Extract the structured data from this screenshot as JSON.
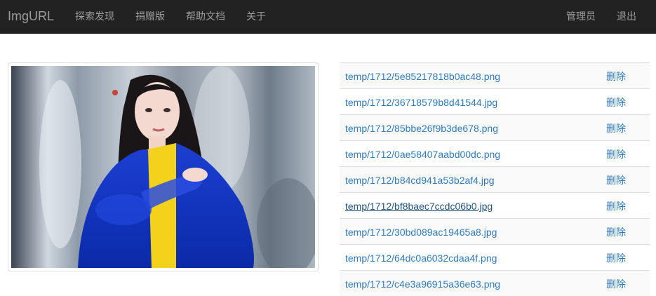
{
  "navbar": {
    "brand": "ImgURL",
    "left_links": [
      "探索发现",
      "捐赠版",
      "帮助文档",
      "关于"
    ],
    "right_links": [
      "管理员",
      "退出"
    ]
  },
  "preview": {
    "alt": "photo of a woman in blue and yellow costume"
  },
  "files": [
    {
      "path": "temp/1712/5e85217818b0ac48.png",
      "action": "删除"
    },
    {
      "path": "temp/1712/36718579b8d41544.jpg",
      "action": "删除"
    },
    {
      "path": "temp/1712/85bbe26f9b3de678.png",
      "action": "删除"
    },
    {
      "path": "temp/1712/0ae58407aabd00dc.png",
      "action": "删除"
    },
    {
      "path": "temp/1712/b84cd941a53b2af4.jpg",
      "action": "删除"
    },
    {
      "path": "temp/1712/bf8baec7ccdc06b0.jpg",
      "action": "删除"
    },
    {
      "path": "temp/1712/30bd089ac19465a8.jpg",
      "action": "删除"
    },
    {
      "path": "temp/1712/64dc0a6032cdaa4f.png",
      "action": "删除"
    },
    {
      "path": "temp/1712/c4e3a96915a36e63.png",
      "action": "删除"
    }
  ],
  "colors": {
    "navbar_bg": "#222222",
    "link": "#337ab7",
    "link_hover": "#23527c"
  }
}
